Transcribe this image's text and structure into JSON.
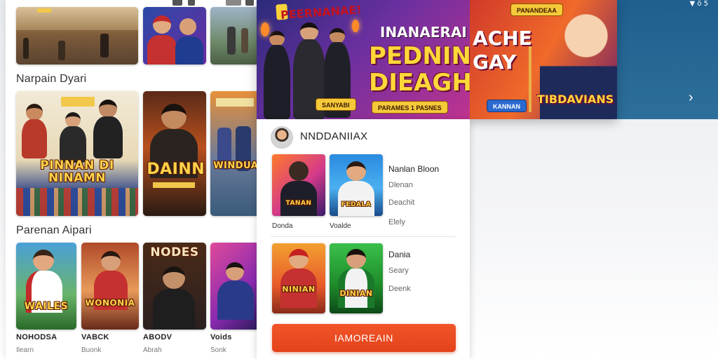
{
  "status": {
    "right_text": "▼ ö 5"
  },
  "left": {
    "section1_title": "Narpain Dyari",
    "section2_title": "Parenan Aipari",
    "poster_feature_title": "PINNAN DI NINAMN",
    "poster_dain_title": "DAINN",
    "poster_side_title": "WINDUAN",
    "row2": [
      {
        "poster": "WAILES",
        "caption": "NOHODSA",
        "sub": "Ilearn"
      },
      {
        "poster": "WONONIA",
        "caption": "VABCK",
        "sub": "Buonk"
      },
      {
        "poster": "NODES",
        "caption": "ABODV",
        "sub": "Abrah"
      },
      {
        "poster": "",
        "caption": "Voids",
        "sub": "Sonk"
      }
    ]
  },
  "banner": {
    "top_badge": "PEERNANAE!",
    "headline_1": "INANAERAI",
    "headline_2": "PEDNIN",
    "headline_3": "DIEAGH!",
    "badge_1": "SANYABI",
    "badge_2": "PARAMES 1 PASNES",
    "side_badge": "PANANDEAA",
    "side_title_1": "ACHE",
    "side_title_2": "GAY",
    "side_badge_2": "KANNAN",
    "side_sign": "TIBDAVIANS"
  },
  "card": {
    "title": "NNDDANIIAX",
    "rows": [
      {
        "thumb_a_caption": "Donda",
        "thumb_b_caption": "Voalde",
        "heading": "Nanlan Bloon",
        "lines": [
          "Dlenan",
          "Deachit",
          "Elely"
        ],
        "thumb_a_poster": "TANAN",
        "thumb_b_poster": "FEDALA"
      },
      {
        "heading": "Dania",
        "lines": [
          "Seary",
          "Deenk"
        ],
        "thumb_a_poster": "NINIAN",
        "thumb_b_poster": "DINIAN"
      }
    ],
    "cta_label": "IAMOREAIN"
  },
  "colors": {
    "accent": "#e3431b",
    "poster_gold": "#ffd34a",
    "banner_purple": "#6b2fa0"
  },
  "icons": {
    "status": "battery-icon",
    "next": "chevron-right-icon",
    "avatar": "user-avatar"
  }
}
